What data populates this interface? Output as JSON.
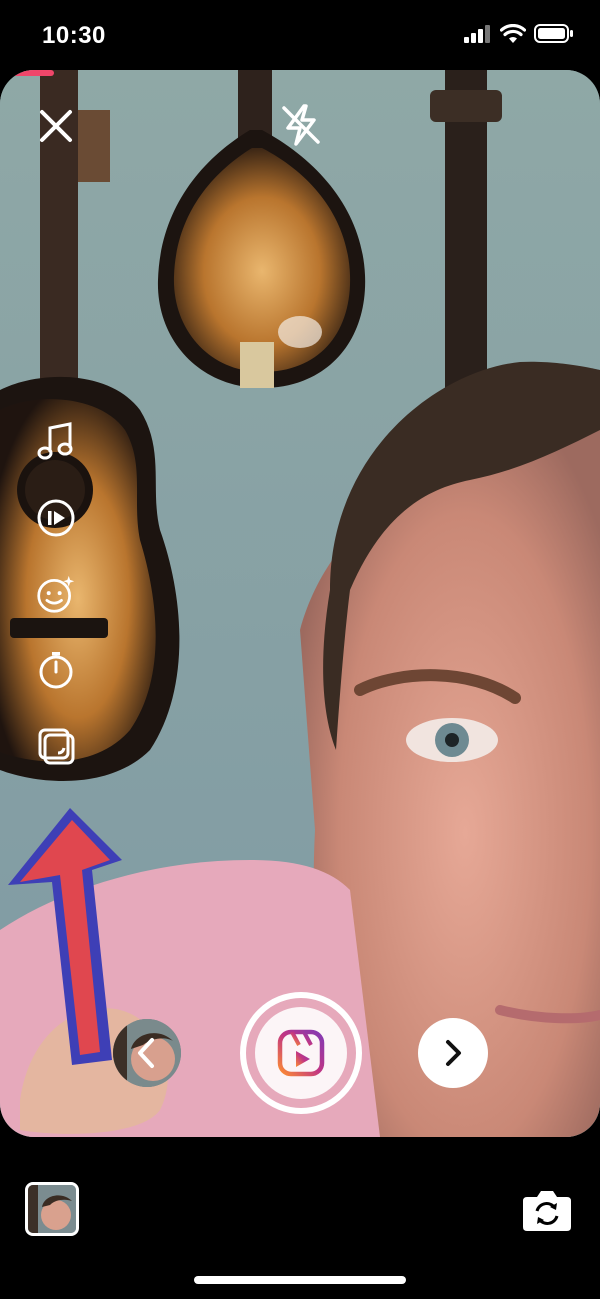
{
  "status_bar": {
    "time": "10:30",
    "icons": [
      "signal-icon",
      "wifi-icon",
      "battery-icon"
    ]
  },
  "camera": {
    "recording_progress": 0.09,
    "top_controls": {
      "close": {
        "icon": "close-icon"
      },
      "flash": {
        "icon": "flash-off-icon"
      }
    },
    "side_tools": [
      {
        "name": "audio",
        "icon": "music-note-icon"
      },
      {
        "name": "speed",
        "icon": "speed-icon"
      },
      {
        "name": "effects",
        "icon": "effects-icon"
      },
      {
        "name": "timer",
        "icon": "timer-icon"
      },
      {
        "name": "layout",
        "icon": "layout-icon"
      }
    ],
    "capture": {
      "effect_thumbnail": "face-thumbnail",
      "prev_icon": "chevron-left-icon",
      "shutter_icon": "reels-icon",
      "next_icon": "chevron-right-icon"
    }
  },
  "bottom_bar": {
    "gallery_icon": "gallery-thumbnail",
    "flip_icon": "flip-camera-icon"
  },
  "colors": {
    "accent": "#f0466a",
    "reels_gradient": [
      "#fd8d32",
      "#c13584",
      "#833ab4"
    ],
    "wall": "#8fa9a5",
    "shirt": "#e6a9bb"
  }
}
